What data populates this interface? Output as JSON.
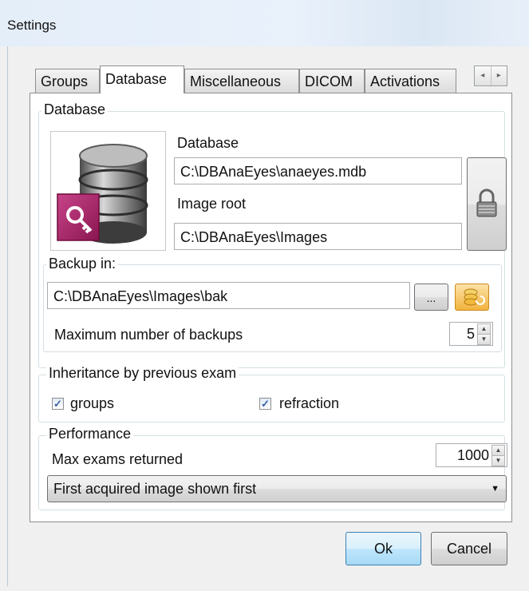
{
  "window": {
    "title": "Settings"
  },
  "tabs": [
    {
      "label": "Groups"
    },
    {
      "label": "Database"
    },
    {
      "label": "Miscellaneous"
    },
    {
      "label": "DICOM"
    },
    {
      "label": "Activations"
    }
  ],
  "tab_scroll": {
    "left": "◂",
    "right": "▸"
  },
  "database_group": {
    "label": "Database",
    "database_label": "Database",
    "database_value": "C:\\DBAnaEyes\\anaeyes.mdb",
    "image_root_label": "Image root",
    "image_root_value": "C:\\DBAnaEyes\\Images"
  },
  "backup_group": {
    "label": "Backup in:",
    "path_value": "C:\\DBAnaEyes\\Images\\bak",
    "browse_label": "...",
    "max_backups_label": "Maximum number of backups",
    "max_backups_value": "5"
  },
  "inheritance_group": {
    "label": "Inheritance by previous exam",
    "groups_label": "groups",
    "groups_checked": true,
    "refraction_label": "refraction",
    "refraction_checked": true
  },
  "performance_group": {
    "label": "Performance",
    "max_exams_label": "Max exams returned",
    "max_exams_value": "1000",
    "order_selected": "First acquired image shown first"
  },
  "footer": {
    "ok_label": "Ok",
    "cancel_label": "Cancel"
  },
  "colors": {
    "window_bg": "#f0f0f0",
    "panel_bg": "#ffffff",
    "ok_border": "#3c7fb1",
    "backup_button": "#f2b33d"
  }
}
